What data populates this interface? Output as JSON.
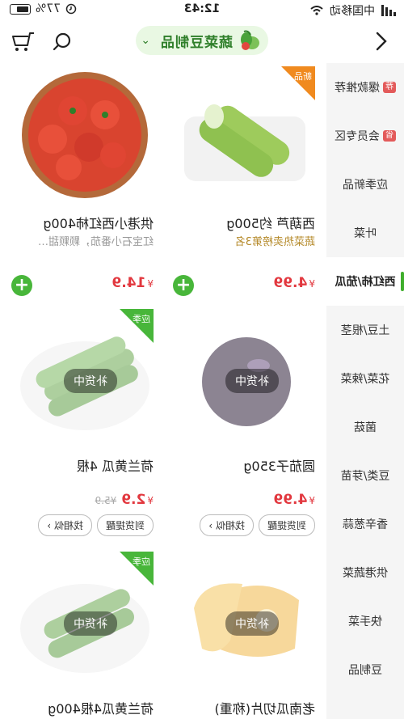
{
  "status": {
    "time": "12:43",
    "carrier": "中国移动",
    "battery": "77%"
  },
  "nav": {
    "title": "蔬菜豆制品"
  },
  "sidebar": {
    "items": [
      {
        "label": "爆款推荐",
        "tag": "荐"
      },
      {
        "label": "会员专区",
        "tag": "省"
      },
      {
        "label": "应季新品"
      },
      {
        "label": "叶菜"
      },
      {
        "label": "西红柿/茄瓜",
        "active": true
      },
      {
        "label": "土豆/根茎"
      },
      {
        "label": "花菜/辣菜"
      },
      {
        "label": "菌菇"
      },
      {
        "label": "豆类/芽苗"
      },
      {
        "label": "香辛葱蒜"
      },
      {
        "label": "供港蔬菜"
      },
      {
        "label": "快手菜"
      },
      {
        "label": "豆制品"
      },
      {
        "label": "…"
      }
    ]
  },
  "products": [
    {
      "name": "西葫芦 约500g",
      "sub": "蔬菜热卖榜第3名",
      "price": "4.99",
      "badge": "新品"
    },
    {
      "name": "供港小西红柿400g",
      "sub": "红宝石小番茄，颗颗甜…",
      "price": "14.9"
    },
    {
      "name": "圆茄子350g",
      "price": "4.99",
      "overlay": "补货中",
      "btn1": "到货提醒",
      "btn2": "找相似 ›"
    },
    {
      "name": "荷兰黄瓜 4根",
      "price": "2.9",
      "old_price": "¥5.9",
      "overlay": "补货中",
      "badge": "应季",
      "btn1": "到货提醒",
      "btn2": "找相似 ›"
    },
    {
      "name": "老南瓜切片(称重)",
      "overlay": "补货中"
    },
    {
      "name": "荷兰黄瓜4根400g",
      "overlay": "补货中",
      "badge": "应季"
    }
  ],
  "currency": "¥",
  "colors": {
    "accent": "#48b63a",
    "price": "#e2383f",
    "pill": "#e9f8e3"
  }
}
